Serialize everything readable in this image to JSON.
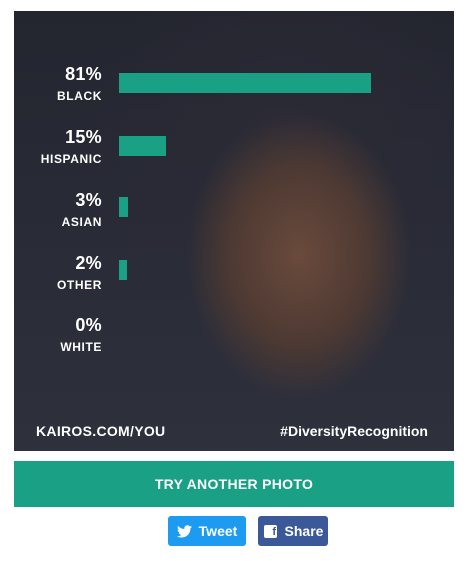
{
  "results": [
    {
      "percent": "81%",
      "label": "BLACK",
      "value": 81
    },
    {
      "percent": "15%",
      "label": "HISPANIC",
      "value": 15
    },
    {
      "percent": "3%",
      "label": "ASIAN",
      "value": 3
    },
    {
      "percent": "2%",
      "label": "OTHER",
      "value": 2
    },
    {
      "percent": "0%",
      "label": "WHITE",
      "value": 0
    }
  ],
  "footer": {
    "site": "KAIROS.COM/YOU",
    "hashtag": "#DiversityRecognition"
  },
  "actions": {
    "try_again": "TRY ANOTHER PHOTO",
    "tweet": "Tweet",
    "share": "Share"
  },
  "colors": {
    "accent": "#1aa085",
    "twitter": "#1d9bf0",
    "facebook": "#3b5998"
  },
  "icons": {
    "tweet": "twitter-bird-icon",
    "share": "facebook-icon"
  }
}
